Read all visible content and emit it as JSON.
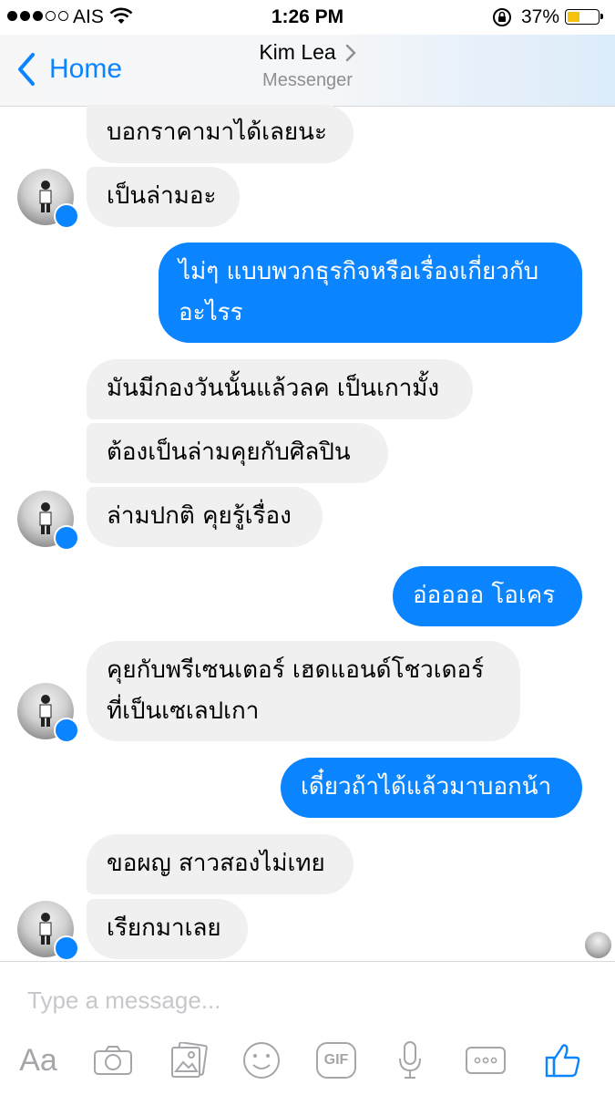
{
  "status_bar": {
    "carrier": "AIS",
    "time": "1:26 PM",
    "battery_percent": "37%"
  },
  "nav": {
    "back_label": "Home",
    "contact_name": "Kim Lea",
    "subtitle": "Messenger"
  },
  "messages": [
    {
      "from": "them",
      "text": "บอกราคามาได้เลยนะ"
    },
    {
      "from": "them",
      "text": "เป็นล่ามอะ"
    },
    {
      "from": "me",
      "lines": [
        "ไม่ๆ แบบพวกธุรกิจหรือเรื่องเกี่ยวกับ",
        "อะไรร"
      ]
    },
    {
      "from": "them",
      "text": "มันมีกองวันนั้นแล้วลค เป็นเกามั้ง"
    },
    {
      "from": "them",
      "text": "ต้องเป็นล่ามคุยกับศิลปิน"
    },
    {
      "from": "them",
      "text": "ล่ามปกติ คุยรู้เรื่อง"
    },
    {
      "from": "me",
      "text": "อ่ออออ โอเคร"
    },
    {
      "from": "them",
      "lines": [
        "คุยกับพรีเซนเตอร์ เฮดแอนด์โชวเดอร์",
        "ที่เป็นเซเลปเกา"
      ]
    },
    {
      "from": "me",
      "text": "เดี๋ยวถ้าได้แล้วมาบอกน้า"
    },
    {
      "from": "them",
      "text": "ขอผญ สาวสองไม่เทย"
    },
    {
      "from": "them",
      "text": "เรียกมาเลย"
    }
  ],
  "composer": {
    "placeholder": "Type a message...",
    "toolbar": {
      "text_label": "Aa",
      "gif_label": "GIF"
    }
  },
  "colors": {
    "accent": "#0a84ff",
    "incoming_bubble": "#f1f0f0",
    "battery_fill": "#f4c20d"
  }
}
